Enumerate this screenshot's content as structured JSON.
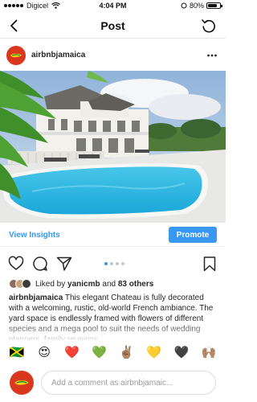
{
  "status_bar": {
    "carrier": "Digicel",
    "time": "4:04 PM",
    "battery_percent": "80%",
    "battery_level": 0.8
  },
  "nav": {
    "title": "Post",
    "back_icon": "chevron-left-icon",
    "refresh_icon": "refresh-icon"
  },
  "post": {
    "username": "airbnbjamaica",
    "image_alt": "photo",
    "carousel_count": 4,
    "carousel_active": 0
  },
  "insights": {
    "view_label": "View Insights",
    "promote_label": "Promote"
  },
  "likes": {
    "prefix": "Liked by",
    "user": "yanicmb",
    "and": "and",
    "count": "83 others"
  },
  "caption": {
    "username": "airbnbjamaica",
    "text": "This elegant Chateau is fully decorated with a welcoming, rustic, old-world French ambiance. The yard space is endlessly framed with flowers of different species and a mega pool  to suit the needs of wedding planners, family reunions,"
  },
  "emojis": [
    "🇯🇲",
    "😍",
    "❤️",
    "💚",
    "✌🏽",
    "💛",
    "🖤",
    "🙌🏽"
  ],
  "comment": {
    "placeholder": "Add a comment as airbnbjamaic..."
  },
  "colors": {
    "accent": "#3897f0",
    "avatar": "#d9381e"
  }
}
